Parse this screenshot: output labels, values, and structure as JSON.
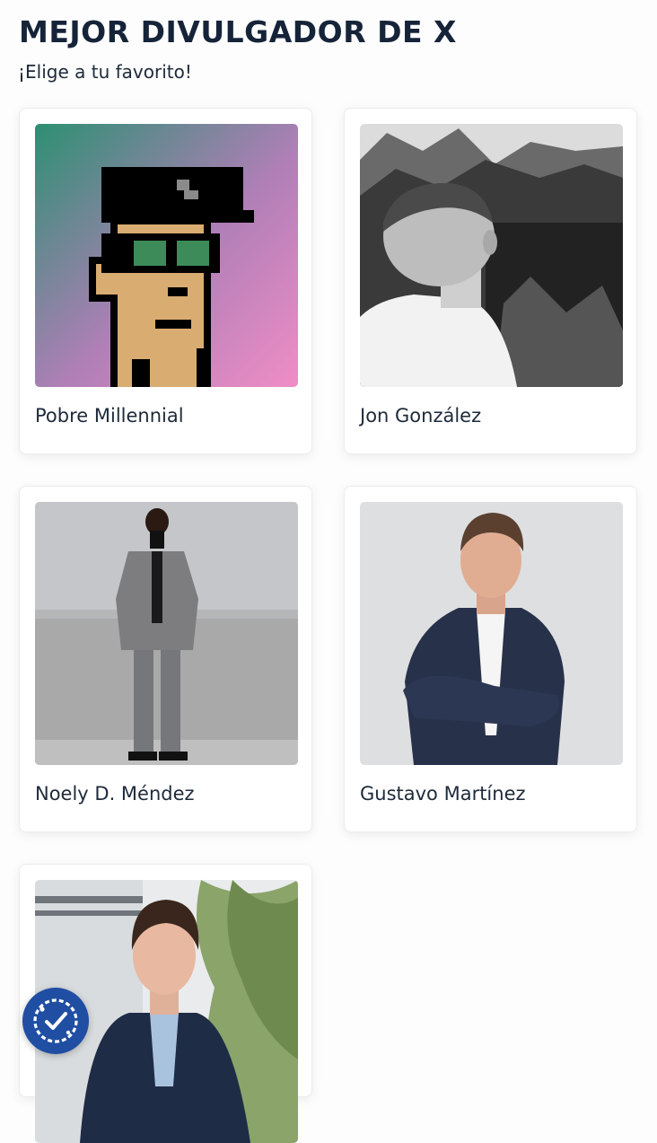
{
  "header": {
    "title": "MEJOR DIVULGADOR DE X",
    "subtitle": "¡Elige a tu favorito!"
  },
  "candidates": [
    {
      "name": "Pobre Millennial",
      "photo": "pixel-art-avatar-icon"
    },
    {
      "name": "Jon González",
      "photo": "man-mountains-photo"
    },
    {
      "name": "Noely D. Méndez",
      "photo": "man-on-stage-photo"
    },
    {
      "name": "Gustavo Martínez",
      "photo": "man-crossed-arms-photo"
    },
    {
      "name": "",
      "photo": "man-suit-outdoor-photo"
    }
  ],
  "floating_button": {
    "icon": "badge-check-icon"
  },
  "colors": {
    "title": "#162439",
    "accent": "#1f4ea3",
    "card_background": "#ffffff",
    "page_background": "#fdfdfd"
  }
}
